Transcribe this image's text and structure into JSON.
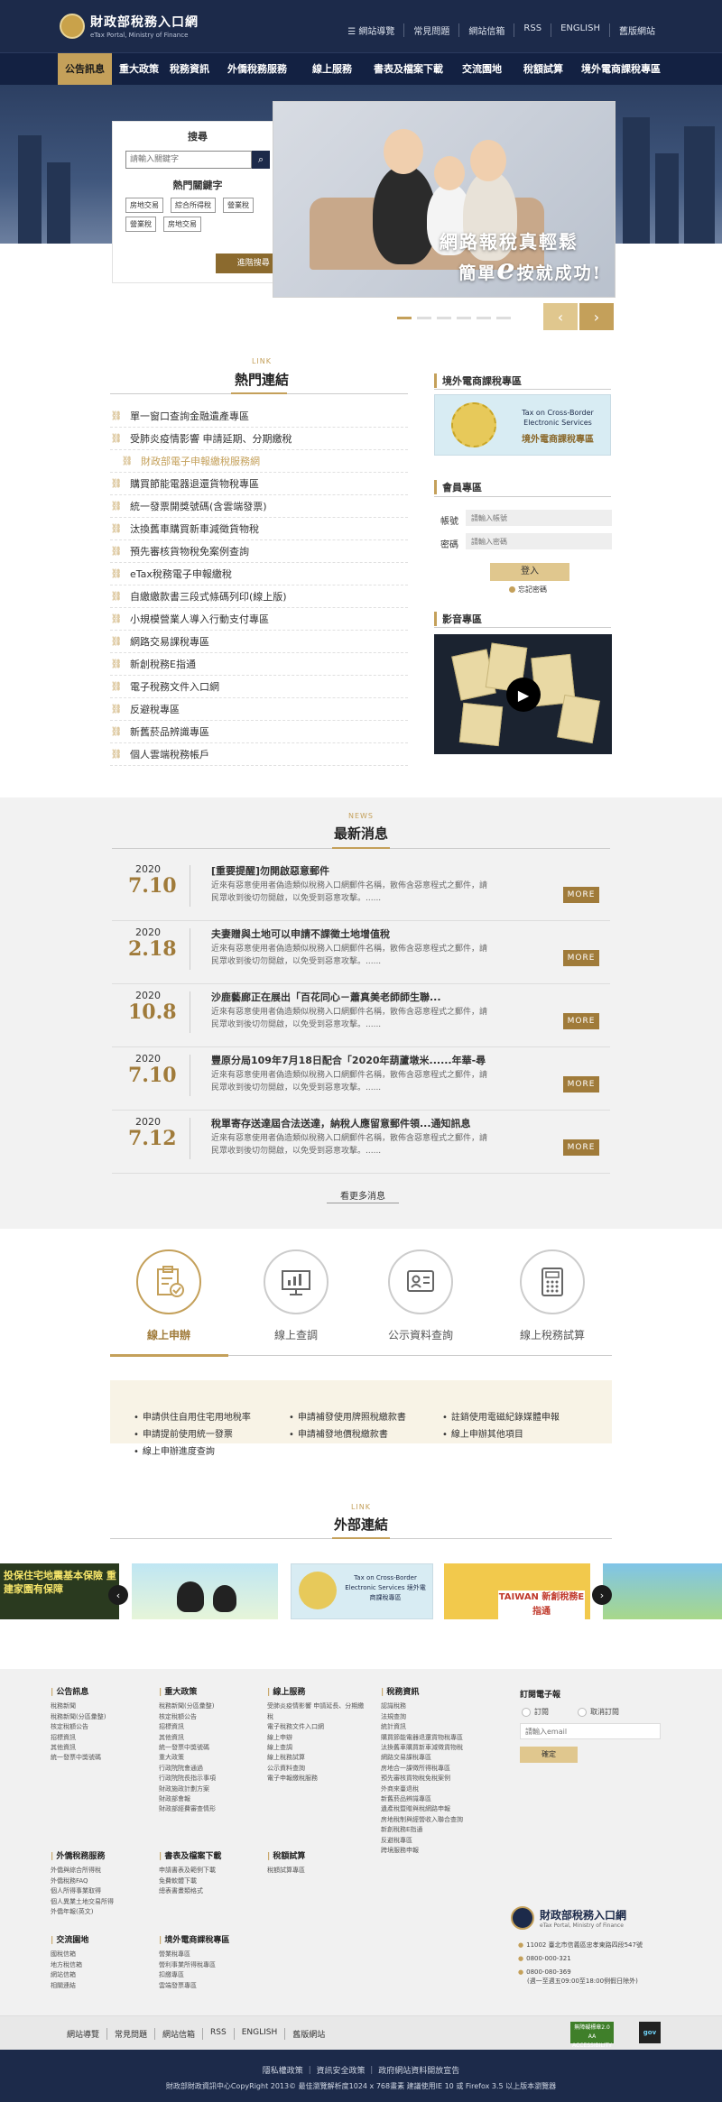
{
  "header": {
    "logo_zh": "財政部稅務入口網",
    "logo_en": "eTax Portal, Ministry of Finance",
    "top_links": [
      "網站導覽",
      "常見問題",
      "網站信箱",
      "RSS",
      "ENGLISH",
      "舊版網站"
    ]
  },
  "nav": {
    "items": [
      "公告訊息",
      "重大政策",
      "稅務資訊",
      "外僑稅務服務",
      "線上服務",
      "書表及檔案下載",
      "交流園地",
      "稅額試算",
      "境外電商課稅專區"
    ],
    "active_index": 0
  },
  "search": {
    "title": "搜尋",
    "placeholder": "請輸入關鍵字",
    "hot_title": "熱門關鍵字",
    "keywords": [
      "房地交易",
      "綜合所得稅",
      "營業稅",
      "營業稅",
      "房地交易"
    ],
    "advanced_label": "進階搜尋"
  },
  "hero": {
    "caption_line1": "網路報稅真輕鬆",
    "caption_line2_a": "簡單",
    "caption_line2_big": "e",
    "caption_line2_b": "按就成功!",
    "slide_count": 6,
    "active_slide": 0
  },
  "hot_links": {
    "tag": "LINK",
    "title": "熱門連結",
    "items": [
      "單一窗口查詢金融遺產專區",
      "受肺炎疫情影響 申請延期、分期繳稅",
      "財政部電子申報繳稅服務網",
      "購買節能電器退還貨物稅專區",
      "統一發票開獎號碼(含雲端發票)",
      "汰換舊車購買新車減徵貨物稅",
      "預先審核貨物稅免案例查詢",
      "eTax稅務電子申報繳稅",
      "自繳繳款書三段式條碼列印(線上版)",
      "小規模營業人導入行動支付專區",
      "網路交易課稅專區",
      "新創稅務E指通",
      "電子稅務文件入口網",
      "反避稅專區",
      "新舊菸品辨識專區",
      "個人雲端稅務帳戶"
    ],
    "highlight_index": 2
  },
  "sidebar": {
    "ecom_title": "境外電商課稅專區",
    "ecom_en": "Tax on Cross-Border Electronic Services",
    "ecom_zh": "境外電商課稅專區",
    "member_title": "會員專區",
    "account_label": "帳號",
    "account_placeholder": "請輸入帳號",
    "password_label": "密碼",
    "password_placeholder": "請輸入密碼",
    "login_label": "登入",
    "forgot_label": "忘記密碼",
    "video_title": "影音專區"
  },
  "news": {
    "tag": "NEWS",
    "title": "最新消息",
    "items": [
      {
        "year": "2020",
        "md": "7.10",
        "title": "[重要提醒]勿開啟惡意郵件",
        "desc": "近來有惡意使用者偽造類似稅務入口網郵件名稱，散佈含惡意程式之郵件，請民眾收到後切勿開啟，以免受到惡意攻擊。......"
      },
      {
        "year": "2020",
        "md": "2.18",
        "title": "夫妻贈與土地可以申請不課徵土地增值稅",
        "desc": "近來有惡意使用者偽造類似稅務入口網郵件名稱，散佈含惡意程式之郵件，請民眾收到後切勿開啟，以免受到惡意攻擊。......"
      },
      {
        "year": "2020",
        "md": "10.8",
        "title": "沙鹿藝廊正在展出「百花同心－蕭真美老師師生聯...",
        "desc": "近來有惡意使用者偽造類似稅務入口網郵件名稱，散佈含惡意程式之郵件，請民眾收到後切勿開啟，以免受到惡意攻擊。......"
      },
      {
        "year": "2020",
        "md": "7.10",
        "title": "豐原分局109年7月18日配合「2020年葫蘆墩米......年華-尋",
        "desc": "近來有惡意使用者偽造類似稅務入口網郵件名稱，散佈含惡意程式之郵件，請民眾收到後切勿開啟，以免受到惡意攻擊。......"
      },
      {
        "year": "2020",
        "md": "7.12",
        "title": "稅單寄存送達屆合法送達，納稅人應留意郵件領...通知訊息",
        "desc": "近來有惡意使用者偽造類似稅務入口網郵件名稱，散佈含惡意程式之郵件，請民眾收到後切勿開啟，以免受到惡意攻擊。......"
      }
    ],
    "more_label": "MORE",
    "see_more": "看更多消息"
  },
  "services": {
    "tabs": [
      {
        "label": "線上申辦",
        "icon": "clipboard-check-icon"
      },
      {
        "label": "線上查調",
        "icon": "monitor-chart-icon"
      },
      {
        "label": "公示資料查詢",
        "icon": "id-card-icon"
      },
      {
        "label": "線上稅務試算",
        "icon": "calculator-icon"
      }
    ],
    "active_index": 0,
    "items": [
      "申請供住自用住宅用地稅率",
      "申請補發使用牌照稅繳款書",
      "註銷使用電磁紀錄媒體申報",
      "申請提前使用統一發票",
      "申請補發地價稅繳款書",
      "線上申辦其他項目",
      "線上申辦進度查詢"
    ]
  },
  "external": {
    "tag": "LINK",
    "title": "外部連結",
    "cards": [
      "投保住宅地震基本保險 重建家園有保障",
      "",
      "Tax on Cross-Border Electronic Services 境外電商課稅專區",
      "TAIWAN 新創稅務E指通",
      ""
    ]
  },
  "footer": {
    "columns": [
      {
        "title": "公告訊息",
        "items": [
          "稅務新聞",
          "稅務新聞(分區彙整)",
          "核定稅額公告",
          "招標資訊",
          "其他資訊",
          "統一發票中獎號碼"
        ]
      },
      {
        "title": "重大政策",
        "items": [
          "稅務新聞(分區彙整)",
          "核定稅額公告",
          "招標資訊",
          "其他資訊",
          "統一發票中獎號碼",
          "重大政策",
          "行政院院會通過",
          "行政院院長指示事項",
          "財政施政計劃方案",
          "財政部會報",
          "財政部經費審查情形"
        ]
      },
      {
        "title": "線上服務",
        "items": [
          "受肺炎疫情影響 申請延長、分期繳稅",
          "電子稅務文件入口網",
          "線上申辦",
          "線上查調",
          "線上稅務試算",
          "公示資料查詢",
          "電子申報繳稅服務"
        ]
      },
      {
        "title": "稅務資訊",
        "items": [
          "認識稅務",
          "法規查詢",
          "統計資訊",
          "購買節能電器退還貨物稅專區",
          "汰換舊車購買新車減徵貨物稅",
          "網路交易課稅專區",
          "房地合一課徵所得稅專區",
          "預先審核貨物稅免稅案例",
          "外商來臺退稅",
          "新舊菸品辨識專區",
          "遺產稅暨贈與稅網路申報",
          "房地稅制與經營收入聯合查詢",
          "新創稅務E指通",
          "反避稅專區",
          "跨境服務申報"
        ]
      },
      {
        "title": "外僑稅務服務",
        "items": [
          "外僑與綜合所得稅",
          "外僑稅務FAQ",
          "個人所得事業取得",
          "個人異業土地交易所得",
          "外僑年報(英文)"
        ]
      },
      {
        "title": "書表及檔案下載",
        "items": [
          "申請書表及範例下載",
          "免費軟體下載",
          "總表書畫類格式"
        ]
      },
      {
        "title": "稅額試算",
        "items": [
          "稅額試算專區"
        ]
      },
      {
        "title": "交流園地",
        "items": [
          "國稅信箱",
          "地方稅信箱",
          "網站信箱",
          "相關連結"
        ]
      },
      {
        "title": "境外電商課稅專區",
        "items": [
          "營業稅專區",
          "營利事業所得稅專區",
          "扣繳專區",
          "雲端發票專區"
        ]
      }
    ],
    "subscribe_title": "訂閱電子報",
    "subscribe_opt": "訂閱",
    "unsubscribe_opt": "取消訂閱",
    "email_placeholder": "請輸入email",
    "confirm_label": "確定",
    "logo_zh": "財政部稅務入口網",
    "logo_en": "eTax Portal, Ministry of Finance",
    "address": "11002 臺北市信義區忠孝東路四段547號",
    "phone1": "0800-000-321",
    "phone2": "0800-080-369",
    "phone2_note": "(週一至週五09:00至18:00例假日除外)",
    "bottom_links": [
      "網站導覽",
      "常見問題",
      "網站信箱",
      "RSS",
      "ENGLISH",
      "舊版網站"
    ],
    "badge_a": "無障礙標章2.0 AA ACCESSIBILITY",
    "badge_b": "gov",
    "policy_line": "隱私權政策 ｜ 資訊安全政策 ｜ 政府網站資料開放宣告",
    "copyright": "財政部財政資訊中心CopyRight 2013© 最佳瀏覽解析度1024 x 768畫素 建議使用IE 10 或 Firefox 3.5 以上版本瀏覽器"
  }
}
